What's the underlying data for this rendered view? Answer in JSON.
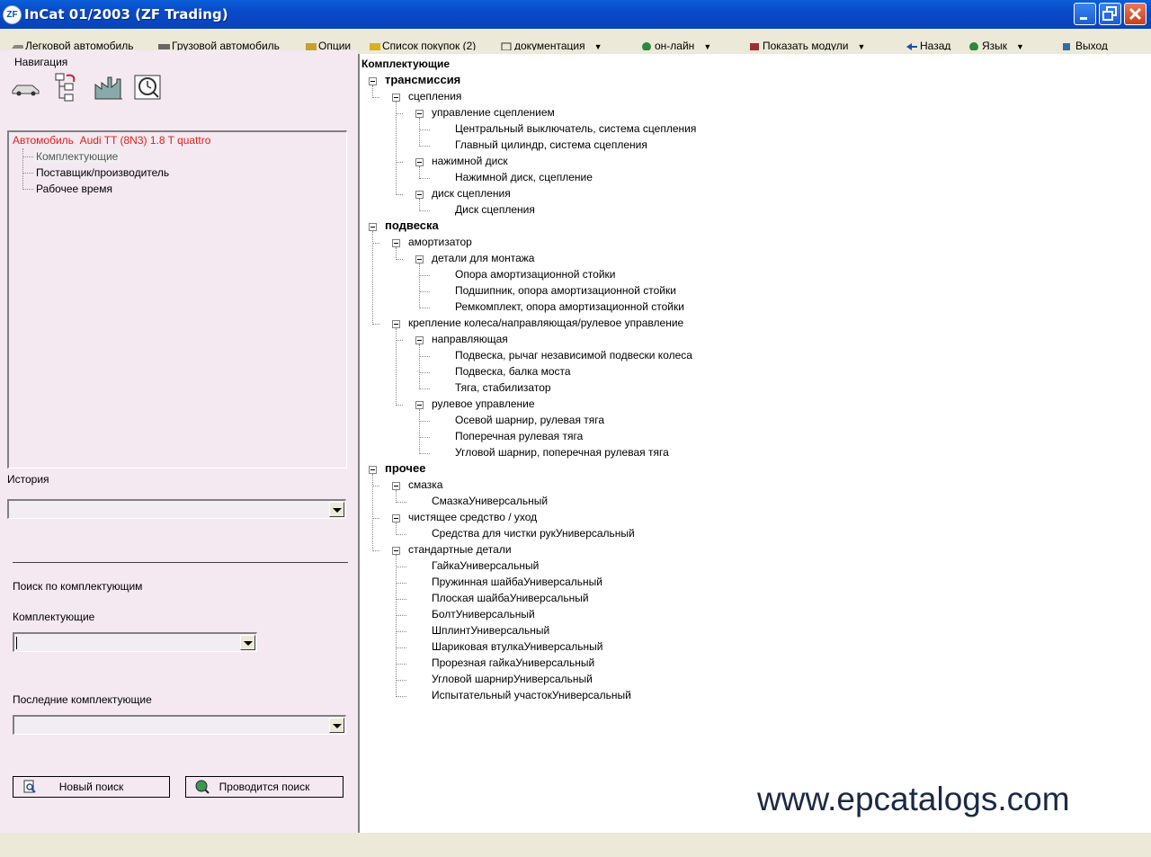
{
  "window": {
    "logo": "ZF",
    "title": "InCat 01/2003 (ZF Trading)"
  },
  "menu": {
    "items": [
      {
        "label": "Легковой автомобиль",
        "icon": "car-icon"
      },
      {
        "label": "Грузовой автомобиль",
        "icon": "truck-icon"
      },
      {
        "label": "Опции",
        "icon": "options-icon"
      },
      {
        "label": "Список покупок (2)",
        "icon": "shopping-list-icon"
      },
      {
        "label": "документация",
        "icon": "documentation-icon"
      },
      {
        "label": "он-лайн",
        "icon": "globe-icon"
      },
      {
        "label": "Показать модули",
        "icon": "modules-icon"
      },
      {
        "label": "Назад",
        "icon": "back-arrow-icon"
      },
      {
        "label": "Язык",
        "icon": "globe-icon"
      },
      {
        "label": "Выход",
        "icon": "exit-icon"
      }
    ]
  },
  "left": {
    "nav_label": "Навигация",
    "vehicle": {
      "prefix": "Автомобиль",
      "model": "Audi TT (8N3) 1.8 T quattro"
    },
    "nav_items": [
      "Комплектующие",
      "Поставщик/производитель",
      "Рабочее время"
    ],
    "history_label": "История",
    "history_value": "",
    "search_title": "Поиск по комплектующим",
    "component_label": "Комплектующие",
    "component_value": "",
    "recent_label": "Последние комплектующие",
    "recent_value": "",
    "new_search_button": "Новый поиск",
    "run_search_button": "Проводится поиск"
  },
  "tree": {
    "header": "Комплектующие",
    "nodes": [
      {
        "label": "трансмиссия",
        "level": 0,
        "bold": true
      },
      {
        "label": "сцепления",
        "level": 1
      },
      {
        "label": "управление сцеплением",
        "level": 2
      },
      {
        "label": "Центральный выключатель, система сцепления",
        "level": 3
      },
      {
        "label": "Главный цилиндр, система сцепления",
        "level": 3
      },
      {
        "label": "нажимной диск",
        "level": 2
      },
      {
        "label": "Нажимной диск, сцепление",
        "level": 3
      },
      {
        "label": "диск сцепления",
        "level": 2
      },
      {
        "label": "Диск сцепления",
        "level": 3
      },
      {
        "label": "подвеска",
        "level": 0,
        "bold": true
      },
      {
        "label": "амортизатор",
        "level": 1
      },
      {
        "label": "детали для монтажа",
        "level": 2
      },
      {
        "label": "Опора амортизационной стойки",
        "level": 3
      },
      {
        "label": "Подшипник, опора амортизационной стойки",
        "level": 3
      },
      {
        "label": "Ремкомплект, опора амортизационной стойки",
        "level": 3
      },
      {
        "label": "крепление колеса/направляющая/рулевое управление",
        "level": 1
      },
      {
        "label": "направляющая",
        "level": 2
      },
      {
        "label": "Подвеска, рычаг независимой подвески колеса",
        "level": 3
      },
      {
        "label": "Подвеска, балка моста",
        "level": 3
      },
      {
        "label": "Тяга, стабилизатор",
        "level": 3
      },
      {
        "label": "рулевое управление",
        "level": 2
      },
      {
        "label": "Осевой шарнир, рулевая тяга",
        "level": 3
      },
      {
        "label": "Поперечная рулевая тяга",
        "level": 3
      },
      {
        "label": "Угловой шарнир, поперечная рулевая тяга",
        "level": 3
      },
      {
        "label": "прочее",
        "level": 0,
        "bold": true
      },
      {
        "label": "смазка",
        "level": 1
      },
      {
        "label": "СмазкаУниверсальный",
        "level": 2
      },
      {
        "label": "чистящее средство / уход",
        "level": 1
      },
      {
        "label": "Средства для чистки рукУниверсальный",
        "level": 2
      },
      {
        "label": "стандартные детали",
        "level": 1
      },
      {
        "label": "ГайкаУниверсальный",
        "level": 2
      },
      {
        "label": "Пружинная шайбаУниверсальный",
        "level": 2
      },
      {
        "label": "Плоская шайбаУниверсальный",
        "level": 2
      },
      {
        "label": "БолтУниверсальный",
        "level": 2
      },
      {
        "label": "ШплинтУниверсальный",
        "level": 2
      },
      {
        "label": "Шариковая втулкаУниверсальный",
        "level": 2
      },
      {
        "label": "Прорезная гайкаУниверсальный",
        "level": 2
      },
      {
        "label": "Угловой шарнирУниверсальный",
        "level": 2
      },
      {
        "label": "Испытательный участокУниверсальный",
        "level": 2
      }
    ]
  },
  "watermark": "www.epcatalogs.com"
}
